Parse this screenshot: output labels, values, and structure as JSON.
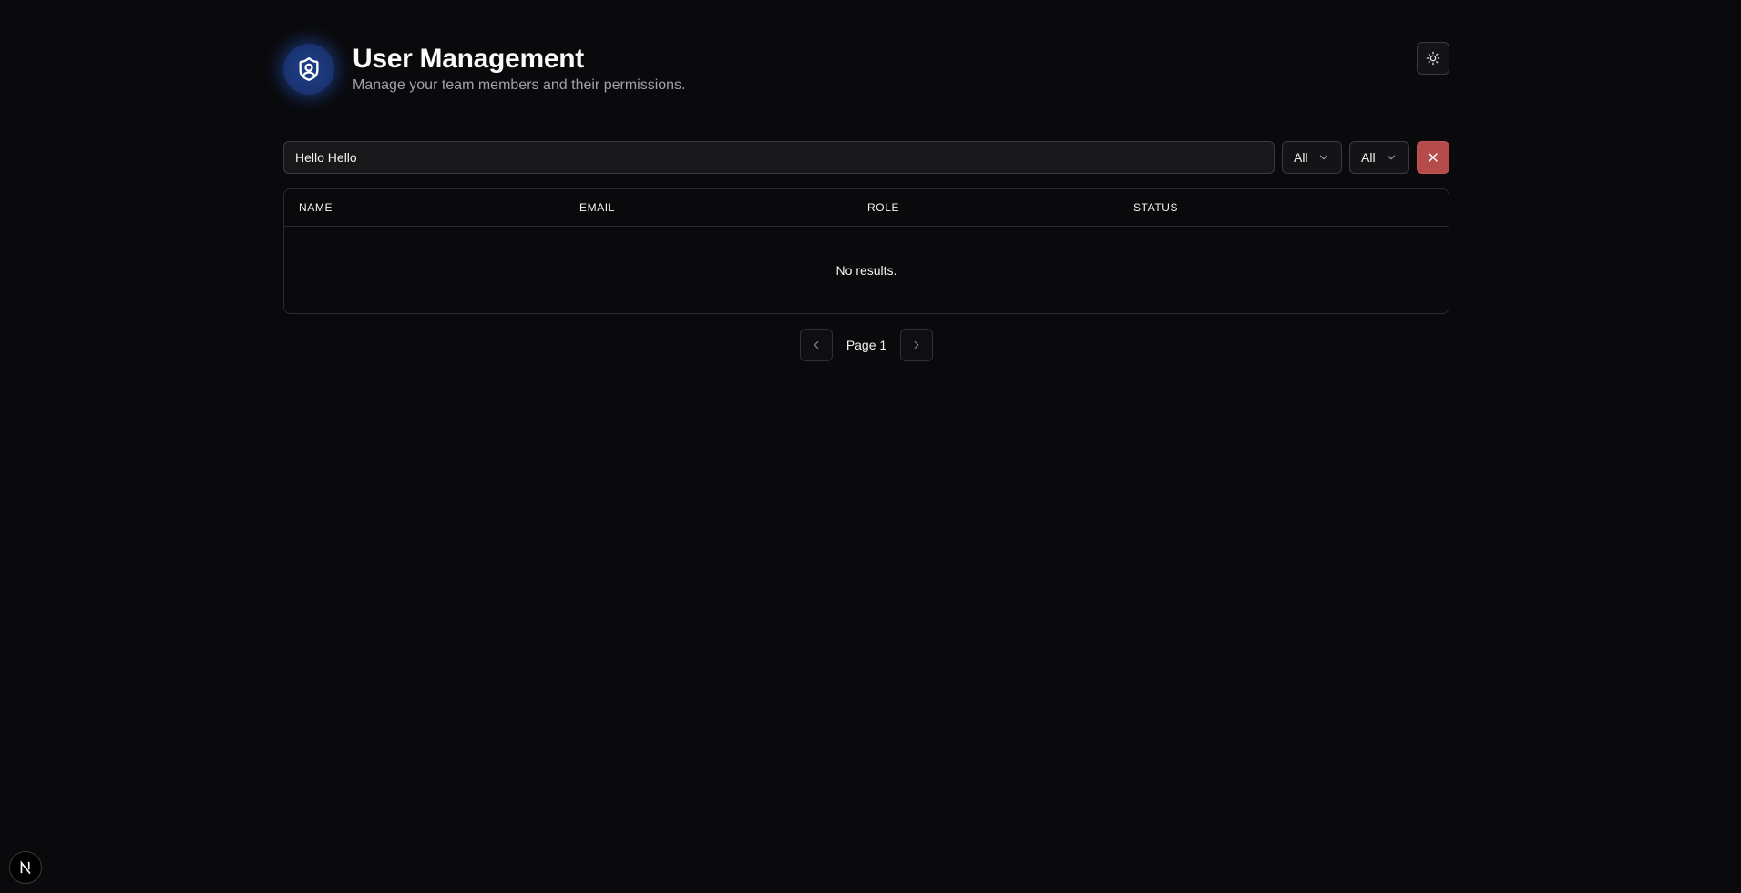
{
  "header": {
    "title": "User Management",
    "subtitle": "Manage your team members and their permissions.",
    "logo_icon": "shield-user-icon",
    "theme_toggle_icon": "sun-icon"
  },
  "toolbar": {
    "search_value": "Hello Hello",
    "role_filter": "All",
    "status_filter": "All",
    "clear_icon": "close-icon"
  },
  "table": {
    "columns": [
      "NAME",
      "EMAIL",
      "ROLE",
      "STATUS"
    ],
    "rows": [],
    "empty_text": "No results."
  },
  "pagination": {
    "label": "Page 1",
    "prev_icon": "chevron-left-icon",
    "next_icon": "chevron-right-icon"
  },
  "badge": {
    "icon": "nextjs-logo-icon"
  },
  "colors": {
    "background": "#0a0a0c",
    "accent": "#1f3f88",
    "danger": "#b54b4b",
    "border": "#2a2a2f"
  }
}
